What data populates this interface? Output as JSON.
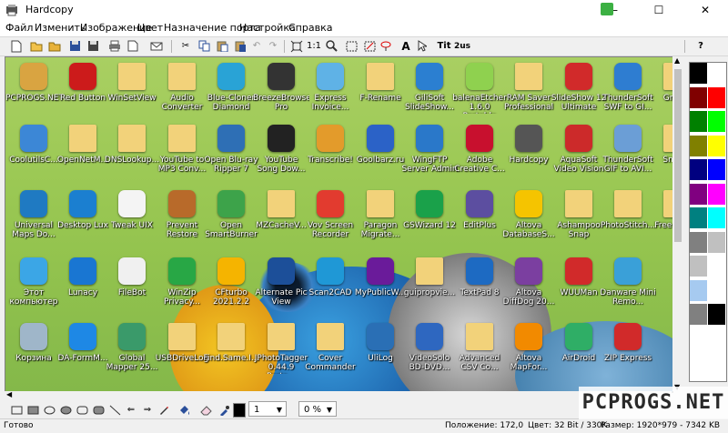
{
  "window": {
    "title": "Hardcopy",
    "controls": [
      "—",
      "☐",
      "✕"
    ]
  },
  "menu": [
    "Файл",
    "Изменить",
    "Изображение",
    "Цвет",
    "Назначение порта",
    "Настройка",
    "Справка"
  ],
  "toolbar": {
    "zoom_label": "1:1",
    "text_label": "A",
    "tit_label": "Tit",
    "zus_label": "2us",
    "help": "?"
  },
  "desktop_icons": [
    [
      "PCPROGS.NET",
      "Red Button",
      "WinSetView",
      "Audio Converter",
      "Blue-Cloner Diamond",
      "BreezeBrowser Pro",
      "Express Invoice...",
      "F-Rename",
      "GiliSoft SlideShow...",
      "balenaEtcher 1.6.0 Portable",
      "RAM Saver Professional",
      "SlideShow 12 Ultimate",
      "ThunderSoft SWF to GI...",
      "Gran..."
    ],
    [
      "CoolutilsC...",
      "OpenNetM...",
      "DNSLookup...",
      "YouTube to MP3 Conv...",
      "Open Blu-ray Ripper 7",
      "YouTube Song Dow...",
      "Transcribe!",
      "Goolbarz.ru",
      "WingFTP Server Admin",
      "Adobe Creative C...",
      "Hardcopy",
      "AquaSoft Video Vision",
      "ThunderSoft GIF to AVI...",
      "Snap..."
    ],
    [
      "Universal Maps Do...",
      "Desktop Lux",
      "Tweak UIX",
      "Prevent Restore",
      "Open SmartBurner",
      "MZCacheV...",
      "Vov Screen Recorder",
      "Paragon Migrate...",
      "GSWizard 12",
      "EditPlus",
      "Altova DatabaseS...",
      "Ashampoo Snap",
      "PhotoStitch...",
      "Free Dow..."
    ],
    [
      "Этот компьютер",
      "Lunacy",
      "FileBot",
      "WinZip Privacy...",
      "CFturbo 2021.2.2",
      "Alternate Pic View",
      "Scan2CAD",
      "MyPublicW...",
      "guipropvie...",
      "TextPad 8",
      "Altova DiffDog 20...",
      "WUUMan",
      "Danware Mini Remo...",
      ""
    ],
    [
      "Корзина",
      "DA-FormM...",
      "Global Mapper 25...",
      "USBDriveLog",
      "Find.Same.I...",
      "JPhotoTagger 0.44.9 Porta...",
      "Cover Commander",
      "UliLog",
      "VideoSolo BD-DVD...",
      "Advanced CSV Co...",
      "Altova MapFor...",
      "AirDroid",
      "ZIP Express",
      ""
    ]
  ],
  "icon_colors": [
    [
      "#d9a441",
      "#cc1b1b",
      "#f2d27a",
      "#f2d27a",
      "#29a3d6",
      "#333333",
      "#5fb2e6",
      "#f2d27a",
      "#2b7fd1",
      "#8fd14f",
      "#f2d27a",
      "#d12a2a",
      "#2e7dd1",
      "#f2d27a"
    ],
    [
      "#3c87d6",
      "#f2d27a",
      "#f2d27a",
      "#f2d27a",
      "#2e6fb5",
      "#222222",
      "#e39b2b",
      "#2b62c7",
      "#2a78c9",
      "#c8102e",
      "#555555",
      "#cc2a2a",
      "#6b9ed6",
      "#f2d27a"
    ],
    [
      "#1f7ac2",
      "#1b7fd0",
      "#f4f4f4",
      "#b86a2a",
      "#3da34a",
      "#f2d27a",
      "#e23b2f",
      "#f2d27a",
      "#1aa14a",
      "#5c4ea0",
      "#f5c400",
      "#f2d27a",
      "#f2d27a",
      "#f2d27a"
    ],
    [
      "#3ba6e6",
      "#1976d2",
      "#f0f0f0",
      "#28a745",
      "#f5b400",
      "#1c4f99",
      "#1f98d6",
      "#6a1b9a",
      "#f2d27a",
      "#1d6ac2",
      "#7b3fa0",
      "#d12a2a",
      "#3aa0d8",
      "#f2d27a"
    ],
    [
      "#9fb6c9",
      "#1e88e5",
      "#3a9a6a",
      "#f2d27a",
      "#f2d27a",
      "#f2d27a",
      "#f2d27a",
      "#2a6fb5",
      "#2e67c0",
      "#f2d27a",
      "#f28a00",
      "#2fae66",
      "#d12a2a",
      "#f2d27a"
    ]
  ],
  "palette": [
    "#000000",
    "#ffffff",
    "#800000",
    "#ff0000",
    "#008000",
    "#00ff00",
    "#808000",
    "#ffff00",
    "#000080",
    "#0000ff",
    "#800080",
    "#ff00ff",
    "#008080",
    "#00ffff",
    "#808080",
    "#c0c0c0",
    "#c0c0c0",
    "#ffffff",
    "#a6caf0",
    "#ffffff",
    "#808080",
    "#000000"
  ],
  "line_width": "1",
  "percent": "0 %",
  "status": {
    "left": "Готово",
    "position": "Положение: 172,0",
    "color": "Цвет: 32 Bit / 330K",
    "size": "Размер: 1920*979  -  7342 KB"
  },
  "watermark": "PCPROGS.NET"
}
